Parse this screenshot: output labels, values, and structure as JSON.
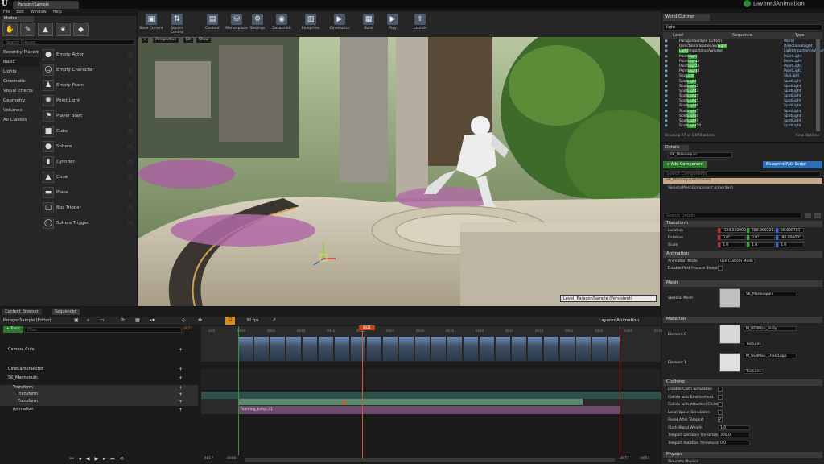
{
  "window": {
    "doc_tab": "ParagonSample",
    "project": "LayeredAnimation",
    "menu": [
      "File",
      "Edit",
      "Window",
      "Help"
    ]
  },
  "modes": {
    "tab": "Modes",
    "search_placeholder": "Search Classes",
    "mode_icons": [
      "place-mode-icon",
      "paint-mode-icon",
      "landscape-mode-icon",
      "foliage-mode-icon",
      "geometry-mode-icon"
    ],
    "categories": [
      "Recently Placed",
      "Basic",
      "Lights",
      "Cinematic",
      "Visual Effects",
      "Geometry",
      "Volumes",
      "All Classes"
    ],
    "selected_category": "Basic",
    "items": [
      {
        "label": "Empty Actor",
        "icon": "sphere-icon"
      },
      {
        "label": "Empty Character",
        "icon": "character-icon"
      },
      {
        "label": "Empty Pawn",
        "icon": "pawn-icon"
      },
      {
        "label": "Point Light",
        "icon": "light-icon"
      },
      {
        "label": "Player Start",
        "icon": "player-start-icon"
      },
      {
        "label": "Cube",
        "icon": "cube-icon"
      },
      {
        "label": "Sphere",
        "icon": "sphere-icon"
      },
      {
        "label": "Cylinder",
        "icon": "cylinder-icon"
      },
      {
        "label": "Cone",
        "icon": "cone-icon"
      },
      {
        "label": "Plane",
        "icon": "plane-icon"
      },
      {
        "label": "Box Trigger",
        "icon": "box-trigger-icon"
      },
      {
        "label": "Sphere Trigger",
        "icon": "sphere-trigger-icon"
      }
    ]
  },
  "toolbar": {
    "buttons": [
      {
        "label": "Save Current",
        "icon": "save-icon"
      },
      {
        "label": "Source Control",
        "icon": "source-control-icon"
      },
      {
        "label": "Content",
        "icon": "content-icon"
      },
      {
        "label": "Marketplace",
        "icon": "marketplace-icon"
      },
      {
        "label": "Settings",
        "icon": "settings-icon"
      },
      {
        "label": "Datasmith",
        "icon": "datasmith-icon"
      },
      {
        "label": "Blueprints",
        "icon": "blueprints-icon"
      },
      {
        "label": "Cinematics",
        "icon": "cinematics-icon"
      },
      {
        "label": "Build",
        "icon": "build-icon"
      },
      {
        "label": "Play",
        "icon": "play-icon"
      },
      {
        "label": "Launch",
        "icon": "launch-icon"
      }
    ]
  },
  "viewport": {
    "perspective": "Perspective",
    "lit": "Lit",
    "show": "Show",
    "level_label": "Level: ParagonSample (Persistent)"
  },
  "outliner": {
    "tab": "World Outliner",
    "search_value": "light",
    "columns": [
      "Label",
      "Sequence",
      "Type"
    ],
    "rows": [
      {
        "label": "ParagonSample (Editor)",
        "type": "World",
        "hl": ""
      },
      {
        "label": "DirectionalStationaryLight",
        "type": "DirectionalLight",
        "hl": "Light"
      },
      {
        "label": "LightImportanceVolume",
        "type": "LightImportanceVolume",
        "hl": "Light"
      },
      {
        "label": "PointLight",
        "type": "PointLight",
        "hl": "Light"
      },
      {
        "label": "PointLight2",
        "type": "PointLight",
        "hl": "Light"
      },
      {
        "label": "PointLight3",
        "type": "PointLight",
        "hl": "Light"
      },
      {
        "label": "PointLight4",
        "type": "PointLight",
        "hl": "Light"
      },
      {
        "label": "SkyLight",
        "type": "SkyLight",
        "hl": "Light"
      },
      {
        "label": "SpotLight",
        "type": "SpotLight",
        "hl": "Light"
      },
      {
        "label": "SpotLight2",
        "type": "SpotLight",
        "hl": "Light"
      },
      {
        "label": "SpotLight3",
        "type": "SpotLight",
        "hl": "Light"
      },
      {
        "label": "SpotLight4",
        "type": "SpotLight",
        "hl": "Light"
      },
      {
        "label": "SpotLight5",
        "type": "SpotLight",
        "hl": "Light"
      },
      {
        "label": "SpotLight6",
        "type": "SpotLight",
        "hl": "Light"
      },
      {
        "label": "SpotLight7",
        "type": "SpotLight",
        "hl": "Light"
      },
      {
        "label": "SpotLight8",
        "type": "SpotLight",
        "hl": "Light"
      },
      {
        "label": "SpotLight9",
        "type": "SpotLight",
        "hl": "Light"
      },
      {
        "label": "SpotLight10",
        "type": "SpotLight",
        "hl": "Light"
      }
    ],
    "footer": "Showing 27 of 1,075 actors",
    "view_options": "View Options"
  },
  "details": {
    "tab": "Details",
    "name_value": "SK_Mannequin",
    "add_component": "+ Add Component",
    "blueprint_script": "Blueprint/Add Script",
    "components_search": "Search Components",
    "component_instance": "SK_Mannequin(Instance)",
    "component_sub": "SkeletalMeshComponent (Inherited)",
    "details_search": "Search Details",
    "transform": {
      "header": "Transform",
      "location_label": "Location",
      "rotation_label": "Rotation",
      "scale_label": "Scale",
      "location": [
        "-124.222000",
        "780.900121",
        "56.800703"
      ],
      "rotation": [
        "0.0°",
        "0.0°",
        "-90.00000°"
      ],
      "scale": [
        "1.0",
        "1.0",
        "1.0"
      ]
    },
    "animation": {
      "header": "Animation",
      "mode_label": "Animation Mode",
      "mode_value": "Use Custom Mode",
      "disable_label": "Disable Post Process Blueprint"
    },
    "mesh": {
      "header": "Mesh",
      "label": "Skeletal Mesh",
      "value": "SK_Mannequin"
    },
    "materials": {
      "header": "Materials",
      "el0_label": "Element 0",
      "el0_value": "M_UE4Man_Body",
      "el1_label": "Element 1",
      "el1_value": "M_UE4Man_ChestLogo",
      "textures": "Textures"
    },
    "clothing": {
      "header": "Clothing",
      "rows": [
        {
          "label": "Disable Cloth Simulation",
          "value": ""
        },
        {
          "label": "Collide with Environment",
          "value": ""
        },
        {
          "label": "Collide with Attached Children",
          "value": ""
        },
        {
          "label": "Local Space Simulation",
          "value": ""
        },
        {
          "label": "Reset After Teleport",
          "value": "checked"
        },
        {
          "label": "Cloth Blend Weight",
          "value": "1.0"
        },
        {
          "label": "Teleport Distance Threshold",
          "value": "300.0"
        },
        {
          "label": "Teleport Rotation Threshold",
          "value": "0.0"
        }
      ]
    },
    "physics": {
      "header": "Physics",
      "row": "Simulate Physics"
    }
  },
  "sequencer": {
    "tabs": [
      "Content Browser",
      "Sequencer"
    ],
    "breadcrumb": "ParagonSample (Editor)",
    "fps": "30 fps",
    "title": "LayeredAnimation",
    "add_track": "+ Track",
    "filter_placeholder": "Filter",
    "frame_counter": "0021",
    "tracks": [
      {
        "label": "Camera Cuts",
        "indent": 1
      },
      {
        "label": "CineCameraActor",
        "indent": 1
      },
      {
        "label": "SK_Mannequin",
        "indent": 1
      },
      {
        "label": "Transform",
        "indent": 2
      },
      {
        "label": "Transform",
        "indent": 3
      },
      {
        "label": "Transform",
        "indent": 3
      },
      {
        "label": "Animation",
        "indent": 2
      }
    ],
    "ruler_ticks": [
      "-100",
      "0000",
      "0005",
      "0010",
      "0015",
      "0021",
      "0025",
      "0030",
      "0035",
      "0040",
      "0045",
      "0050",
      "0055",
      "0060",
      "0065",
      "0070"
    ],
    "anim_clip": "Running_Jump_01",
    "range_start": "-0017",
    "range_start2": "0000",
    "range_end": "0097",
    "range_end2": "0077",
    "transport": [
      "skip-back-icon",
      "step-back-icon",
      "play-reverse-icon",
      "play-icon",
      "step-forward-icon",
      "skip-forward-icon",
      "loop-icon"
    ]
  }
}
